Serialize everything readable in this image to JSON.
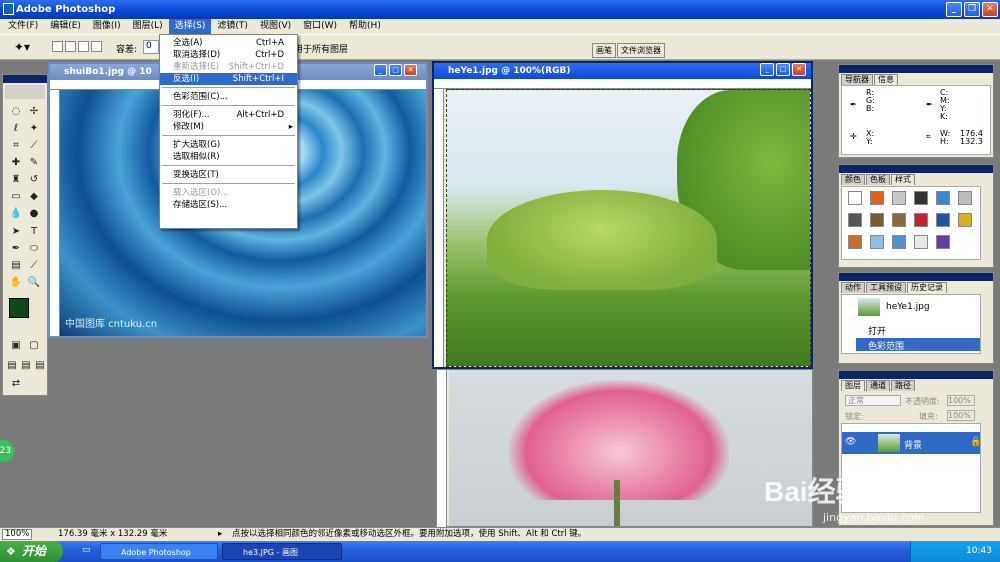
{
  "app": {
    "title": "Adobe Photoshop"
  },
  "menubar": [
    {
      "label": "文件(F)"
    },
    {
      "label": "编辑(E)"
    },
    {
      "label": "图像(I)"
    },
    {
      "label": "图层(L)"
    },
    {
      "label": "选择(S)"
    },
    {
      "label": "滤镜(T)"
    },
    {
      "label": "视图(V)"
    },
    {
      "label": "窗口(W)"
    },
    {
      "label": "帮助(H)"
    }
  ],
  "options": {
    "tolerance_label": "容差:",
    "tolerance_value": "0",
    "all_layers": "用于所有图层",
    "tab1": "画笔",
    "tab2": "文件浏览器"
  },
  "select_menu": {
    "items": [
      {
        "label": "全选(A)",
        "shortcut": "Ctrl+A",
        "disabled": false
      },
      {
        "label": "取消选择(D)",
        "shortcut": "Ctrl+D",
        "disabled": false
      },
      {
        "label": "重新选择(E)",
        "shortcut": "Shift+Ctrl+D",
        "disabled": true
      },
      {
        "label": "反选(I)",
        "shortcut": "Shift+Ctrl+I",
        "disabled": false
      },
      {
        "label": "色彩范围(C)..."
      },
      {
        "label": "羽化(F)...",
        "shortcut": "Alt+Ctrl+D"
      },
      {
        "label": "修改(M)"
      },
      {
        "label": "扩大选取(G)"
      },
      {
        "label": "选取相似(R)"
      },
      {
        "label": "变换选区(T)"
      },
      {
        "label": "载入选区(O)..."
      },
      {
        "label": "存储选区(S)..."
      }
    ]
  },
  "docs": {
    "doc1": {
      "title": "shuiBo1.jpg @ 10",
      "watermark": "中国图库 cntuku.cn"
    },
    "doc2": {
      "title": "heYe1.jpg @ 100%(RGB)"
    }
  },
  "info_panel": {
    "tabs": [
      "导航器",
      "信息"
    ],
    "rgb": [
      "R:",
      "G:",
      "B:"
    ],
    "cmyk": [
      "C:",
      "M:",
      "Y:",
      "K:"
    ],
    "xy": [
      "X:",
      "Y:"
    ],
    "wh_labels": [
      "W:",
      "H:"
    ],
    "w": "176.4",
    "h": "132.3"
  },
  "color_panel": {
    "tabs": [
      "颜色",
      "色板",
      "样式"
    ]
  },
  "history_panel": {
    "tabs": [
      "动作",
      "工具预设",
      "历史记录"
    ],
    "snapshot": "heYe1.jpg",
    "items": [
      "打开",
      "色彩范围"
    ]
  },
  "layers_panel": {
    "tabs": [
      "图层",
      "通道",
      "路径"
    ],
    "blend_mode": "正常",
    "opacity_label": "不透明度:",
    "opacity": "100%",
    "lock_label": "锁定:",
    "fill_label": "填充:",
    "fill": "100%",
    "layer_name": "背景"
  },
  "status": {
    "zoom": "100%",
    "size": "176.39 毫米 x 132.29 毫米",
    "hint": "点按以选择相同颜色的邻近像素或移动选区外框。要用附加选项，使用 Shift、Alt 和 Ctrl 键。"
  },
  "taskbar": {
    "start": "开始",
    "tasks": [
      "Adobe Photoshop",
      "he3.JPG - 画图"
    ],
    "time": "10:43"
  },
  "watermark": {
    "brand": "Bai经验",
    "url": "jingyan.baidu.com"
  },
  "badge": "23",
  "colors": {
    "title": "#0a4bd9",
    "menu_bg": "#ece9d8",
    "highlight": "#316ac5",
    "workspace": "#7b7b7b"
  }
}
